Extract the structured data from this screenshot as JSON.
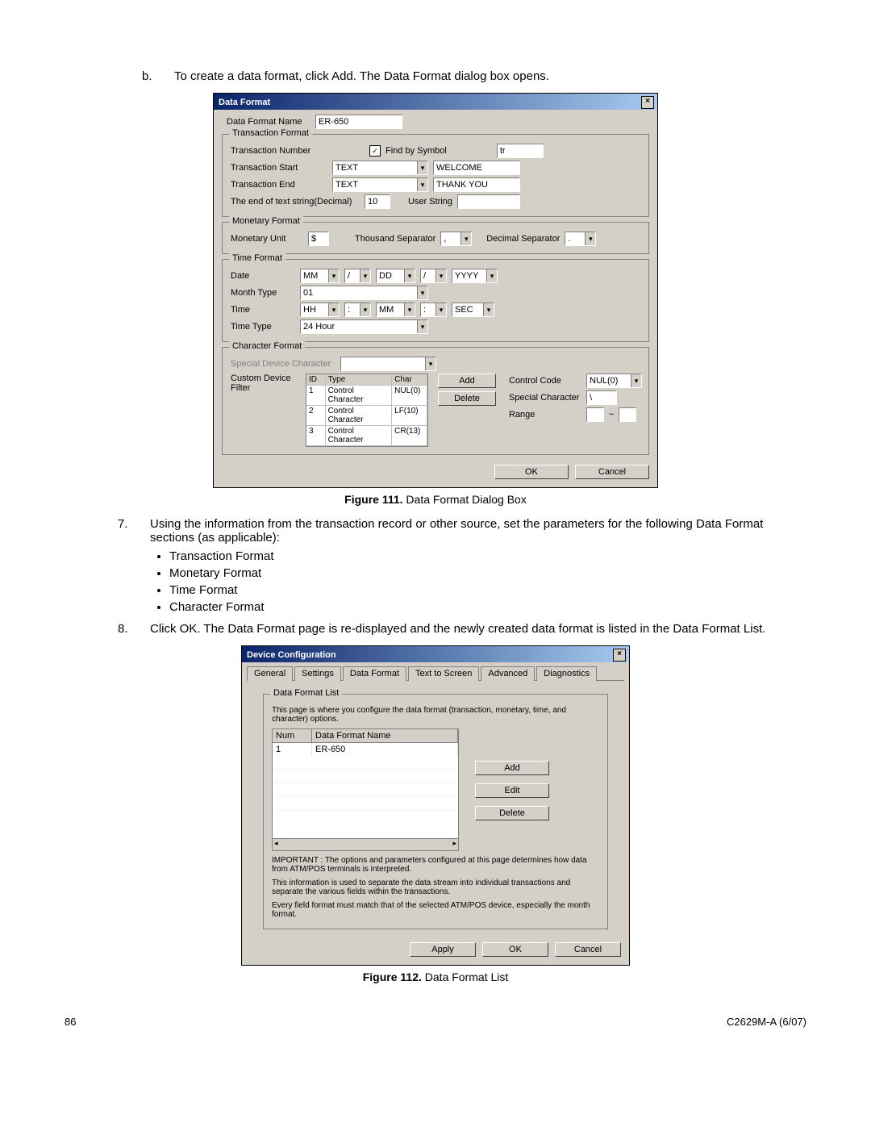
{
  "doc": {
    "step_b_marker": "b.",
    "step_b_text": "To create a data format, click Add. The Data Format dialog box opens.",
    "caption1_label": "Figure 111.",
    "caption1_text": "Data Format Dialog Box",
    "step7_marker": "7.",
    "step7_text": "Using the information from the transaction record or other source, set the parameters for the following Data Format sections (as applicable):",
    "bullets": [
      "Transaction Format",
      "Monetary Format",
      "Time Format",
      "Character Format"
    ],
    "step8_marker": "8.",
    "step8_text": "Click OK. The Data Format page is re-displayed and the newly created data format is listed in the Data Format List.",
    "caption2_label": "Figure 112.",
    "caption2_text": "Data Format List",
    "page_num": "86",
    "doc_id": "C2629M-A (6/07)"
  },
  "dlg1": {
    "title": "Data Format",
    "name_label": "Data Format Name",
    "name_value": "ER-650",
    "grp_trans": "Transaction Format",
    "t_number": "Transaction Number",
    "t_find_chk": "✓",
    "t_find_lbl": "Find by Symbol",
    "t_find_val": "tr",
    "t_start": "Transaction Start",
    "t_start_sel": "TEXT",
    "t_start_val": "WELCOME",
    "t_end": "Transaction End",
    "t_end_sel": "TEXT",
    "t_end_val": "THANK YOU",
    "t_eos": "The end of text string(Decimal)",
    "t_eos_val": "10",
    "t_user": "User String",
    "grp_mon": "Monetary Format",
    "m_unit": "Monetary Unit",
    "m_unit_val": "$",
    "m_thou": "Thousand Separator",
    "m_thou_val": ",",
    "m_dec": "Decimal Separator",
    "m_dec_val": ".",
    "grp_time": "Time Format",
    "date_lbl": "Date",
    "date_p1": "MM",
    "date_s1": "/",
    "date_p2": "DD",
    "date_s2": "/",
    "date_p3": "YYYY",
    "month_lbl": "Month Type",
    "month_val": "01",
    "time_lbl": "Time",
    "time_p1": "HH",
    "time_s1": ":",
    "time_p2": "MM",
    "time_s2": ":",
    "time_p3": "SEC",
    "ttype_lbl": "Time Type",
    "ttype_val": "24 Hour",
    "grp_char": "Character Format",
    "spec_dev": "Special Device Character",
    "cust_filt": "Custom Device Filter",
    "tbl_hdr": [
      "ID",
      "Type",
      "Char"
    ],
    "tbl_rows": [
      [
        "1",
        "Control Character",
        "NUL(0)"
      ],
      [
        "2",
        "Control Character",
        "LF(10)"
      ],
      [
        "3",
        "Control Character",
        "CR(13)"
      ]
    ],
    "add_btn": "Add",
    "del_btn": "Delete",
    "cc_lbl": "Control Code",
    "cc_val": "NUL(0)",
    "sc_lbl": "Special Character",
    "sc_val": "\\",
    "range_lbl": "Range",
    "ok": "OK",
    "cancel": "Cancel"
  },
  "dlg2": {
    "title": "Device Configuration",
    "tabs": [
      "General",
      "Settings",
      "Data Format",
      "Text to Screen",
      "Advanced",
      "Diagnostics"
    ],
    "active_tab": "Data Format",
    "grp": "Data Format List",
    "desc": "This page is where you configure the data format (transaction, monetary, time, and character) options.",
    "col_num": "Num",
    "col_name": "Data Format Name",
    "row_num": "1",
    "row_name": "ER-650",
    "add": "Add",
    "edit": "Edit",
    "delete": "Delete",
    "note1": "IMPORTANT : The options and parameters configured at this page determines how data from ATM/POS terminals is interpreted.",
    "note2": "This information is used to separate the data stream into individual transactions and separate the various fields within the transactions.",
    "note3": "Every field format must match that of the selected ATM/POS device, especially the month format.",
    "apply": "Apply",
    "ok": "OK",
    "cancel": "Cancel"
  }
}
